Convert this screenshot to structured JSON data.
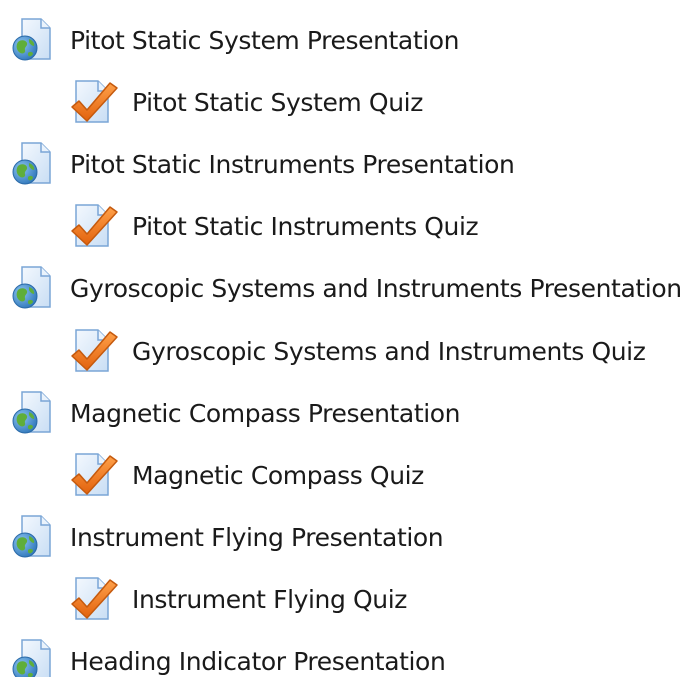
{
  "activities": [
    {
      "type": "resource",
      "icon": "web-page-icon",
      "label": "Pitot Static System Presentation"
    },
    {
      "type": "quiz",
      "icon": "quiz-icon",
      "label": "Pitot Static System Quiz"
    },
    {
      "type": "resource",
      "icon": "web-page-icon",
      "label": "Pitot Static Instruments Presentation"
    },
    {
      "type": "quiz",
      "icon": "quiz-icon",
      "label": "Pitot Static Instruments Quiz"
    },
    {
      "type": "resource",
      "icon": "web-page-icon",
      "label": "Gyroscopic Systems and Instruments Presentation"
    },
    {
      "type": "quiz",
      "icon": "quiz-icon",
      "label": "Gyroscopic Systems and Instruments Quiz"
    },
    {
      "type": "resource",
      "icon": "web-page-icon",
      "label": "Magnetic Compass Presentation"
    },
    {
      "type": "quiz",
      "icon": "quiz-icon",
      "label": "Magnetic Compass Quiz"
    },
    {
      "type": "resource",
      "icon": "web-page-icon",
      "label": "Instrument Flying Presentation"
    },
    {
      "type": "quiz",
      "icon": "quiz-icon",
      "label": "Instrument Flying Quiz"
    },
    {
      "type": "resource",
      "icon": "web-page-icon",
      "label": "Heading Indicator Presentation"
    }
  ],
  "colors": {
    "doc_fill": "#dcebfa",
    "doc_stroke": "#7aa5d6",
    "globe_blue": "#3b86c8",
    "globe_green": "#5fae3a",
    "check_orange": "#f07a1e",
    "check_stroke": "#c55a0e",
    "text": "#1a1a1a"
  }
}
